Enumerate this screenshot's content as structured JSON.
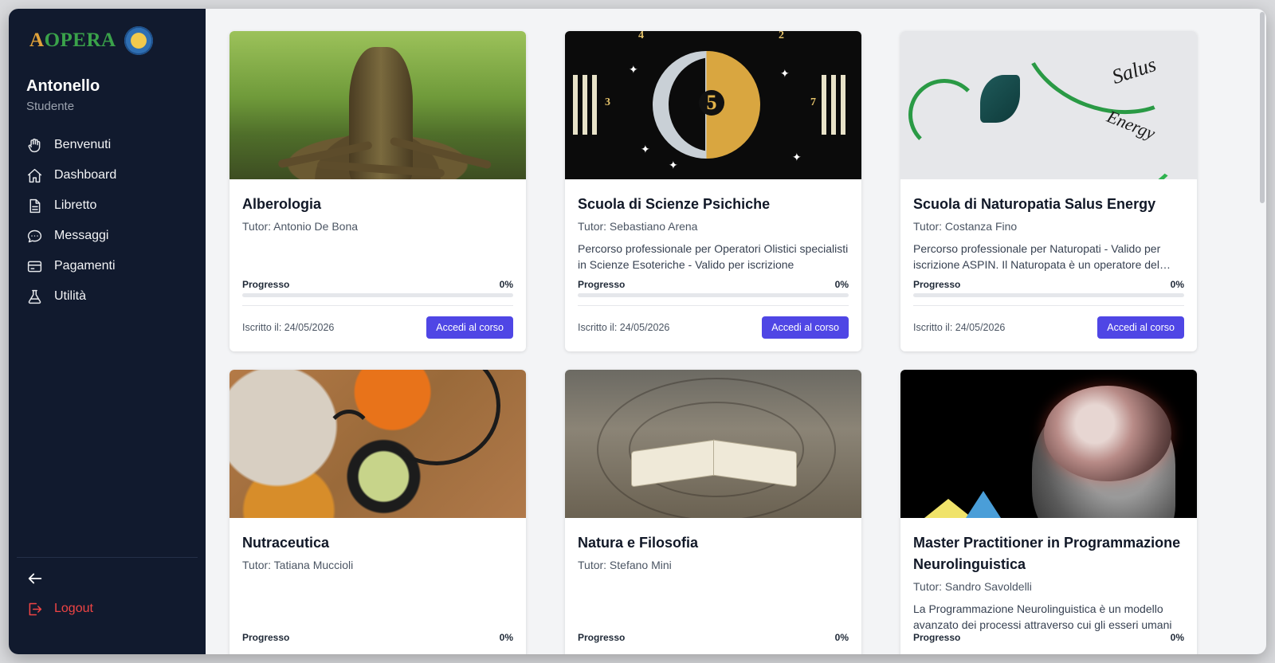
{
  "brand": {
    "logo_text_a": "A",
    "logo_text_rest": "OPERA"
  },
  "user": {
    "name": "Antonello",
    "role": "Studente"
  },
  "nav": [
    {
      "label": "Benvenuti",
      "icon": "hand-icon"
    },
    {
      "label": "Dashboard",
      "icon": "home-icon"
    },
    {
      "label": "Libretto",
      "icon": "document-icon"
    },
    {
      "label": "Messaggi",
      "icon": "chat-icon"
    },
    {
      "label": "Pagamenti",
      "icon": "credit-card-icon"
    },
    {
      "label": "Utilità",
      "icon": "flask-icon"
    }
  ],
  "logout_label": "Logout",
  "colors": {
    "sidebar": "#111a2e",
    "accent": "#4f46e5",
    "logout": "#ef4444"
  },
  "courses": [
    {
      "title": "Alberologia",
      "tutor": "Tutor: Antonio De Bona",
      "description": "",
      "progress_label": "Progresso",
      "progress_value": "0%",
      "progress": 0,
      "enrolled": "Iscritto il: 24/05/2026",
      "button": "Accedi al corso"
    },
    {
      "title": "Scuola di Scienze Psichiche",
      "tutor": "Tutor: Sebastiano Arena",
      "description": "Percorso professionale per Operatori Olistici specialisti in Scienze Esoteriche - Valido per iscrizione",
      "progress_label": "Progresso",
      "progress_value": "0%",
      "progress": 0,
      "enrolled": "Iscritto il: 24/05/2026",
      "button": "Accedi al corso"
    },
    {
      "title": "Scuola di Naturopatia Salus Energy",
      "tutor": "Tutor: Costanza Fino",
      "description": "Percorso professionale per Naturopati - Valido per iscrizione ASPIN. Il Naturopata è un operatore del benessere",
      "progress_label": "Progresso",
      "progress_value": "0%",
      "progress": 0,
      "enrolled": "Iscritto il: 24/05/2026",
      "button": "Accedi al corso"
    },
    {
      "title": "Nutraceutica",
      "tutor": "Tutor: Tatiana Muccioli",
      "description": "",
      "progress_label": "Progresso",
      "progress_value": "0%",
      "progress": 0
    },
    {
      "title": "Natura e Filosofia",
      "tutor": "Tutor: Stefano Mini",
      "description": "",
      "progress_label": "Progresso",
      "progress_value": "0%",
      "progress": 0
    },
    {
      "title": "Master Practitioner in Programmazione Neurolinguistica",
      "tutor": "Tutor: Sandro Savoldelli",
      "description": "La Programmazione Neurolinguistica è un modello avanzato dei processi attraverso cui gli esseri umani",
      "progress_label": "Progresso",
      "progress_value": "0%",
      "progress": 0
    }
  ],
  "image_words": {
    "salus": "Salus",
    "energy": "Energy",
    "five": "5"
  }
}
